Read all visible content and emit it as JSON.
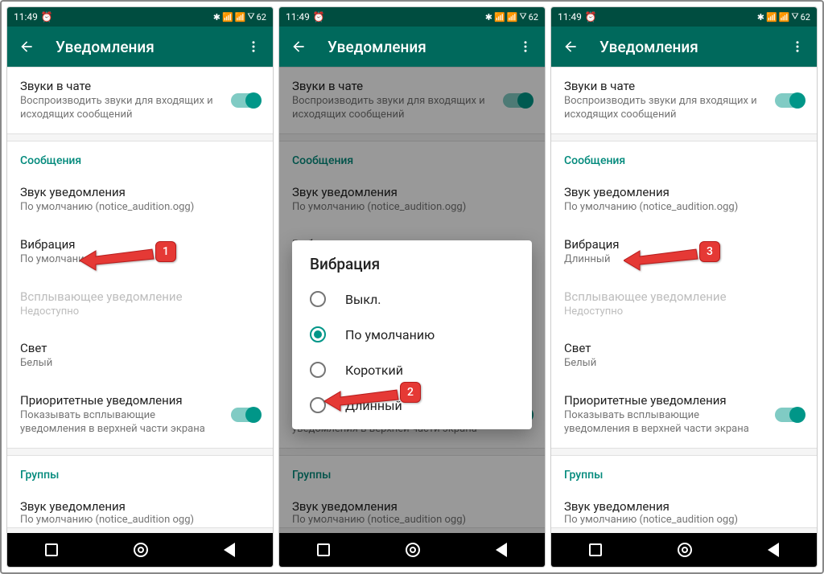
{
  "status": {
    "time": "11:49",
    "battery": "62"
  },
  "appbar": {
    "title": "Уведомления"
  },
  "chat_sounds": {
    "title": "Звуки в чате",
    "subtitle": "Воспроизводить звуки для входящих и исходящих сообщений"
  },
  "section_messages": "Сообщения",
  "sound": {
    "title": "Звук уведомления",
    "subtitle": "По умолчанию (notice_audition.ogg)"
  },
  "vibration": {
    "title": "Вибрация",
    "sub_default": "По умолчанию",
    "sub_long": "Длинный"
  },
  "popup": {
    "title": "Всплывающее уведомление",
    "subtitle": "Недоступно"
  },
  "light": {
    "title": "Свет",
    "subtitle": "Белый"
  },
  "priority": {
    "title": "Приоритетные уведомления",
    "subtitle": "Показывать всплывающие уведомления в верхней части экрана"
  },
  "section_groups": "Группы",
  "group_sound": {
    "title": "Звук уведомления",
    "subtitle": "По умолчанию (notice_audition ogg)"
  },
  "dialog": {
    "title": "Вибрация",
    "opts": [
      "Выкл.",
      "По умолчанию",
      "Короткий",
      "Длинный"
    ]
  },
  "badges": {
    "b1": "1",
    "b2": "2",
    "b3": "3"
  }
}
